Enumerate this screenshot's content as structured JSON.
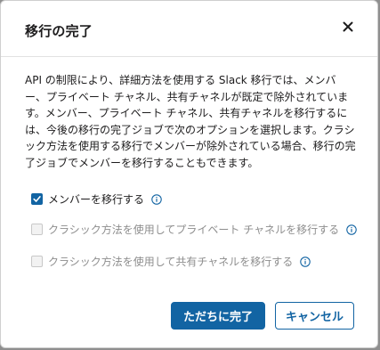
{
  "dialog": {
    "title": "移行の完了",
    "close_icon": "close-icon",
    "description": "API の制限により、詳細方法を使用する Slack 移行では、メンバー、プライベート チャネル、共有チャネルが既定で除外されています。メンバー、プライベート チャネル、共有チャネルを移行するには、今後の移行の完了ジョブで次のオプションを選択します。クラシック方法を使用する移行でメンバーが除外されている場合、移行の完了ジョブでメンバーを移行することもできます。",
    "options": [
      {
        "label": "メンバーを移行する",
        "checked": true,
        "enabled": true
      },
      {
        "label": "クラシック方法を使用してプライベート チャネルを移行する",
        "checked": false,
        "enabled": false
      },
      {
        "label": "クラシック方法を使用して共有チャネルを移行する",
        "checked": false,
        "enabled": false
      }
    ],
    "buttons": {
      "primary_label": "ただちに完了",
      "secondary_label": "キャンセル"
    }
  },
  "colors": {
    "accent": "#1264a3",
    "text": "#1d1c1d",
    "disabled_text": "#8e8e8e",
    "overlay": "#8f8f8f"
  }
}
